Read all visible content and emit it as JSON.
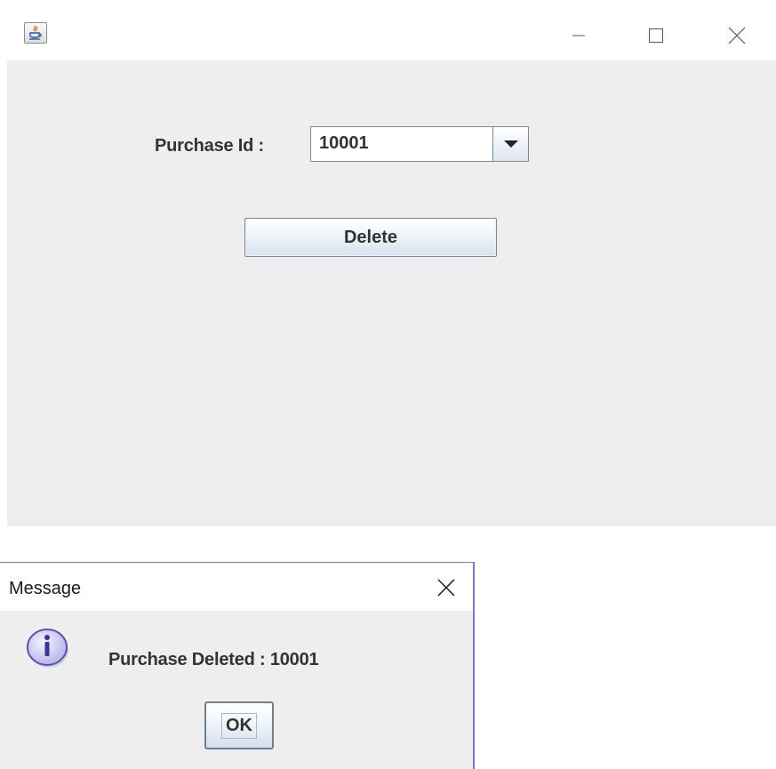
{
  "main_window": {
    "icon": "java-cup-icon",
    "controls": [
      "minimize-icon",
      "maximize-icon",
      "close-icon"
    ],
    "purchase_id_label": "Purchase Id :",
    "purchase_id_value": "10001",
    "delete_label": "Delete"
  },
  "dialog": {
    "title": "Message",
    "message": "Purchase Deleted : 10001",
    "ok_label": "OK",
    "icon": "info-icon"
  },
  "colors": {
    "panel_bg": "#eeeeee",
    "dialog_border": "#7b75d6",
    "info_icon_fill": "#c9c6f0"
  }
}
